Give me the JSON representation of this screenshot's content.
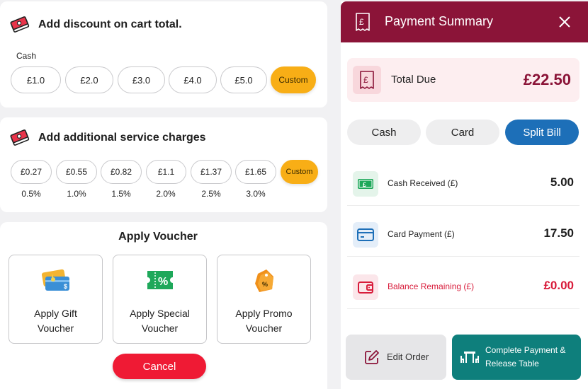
{
  "discount": {
    "title": "Add discount on cart total.",
    "cash_label": "Cash",
    "options": [
      "£1.0",
      "£2.0",
      "£3.0",
      "£4.0",
      "£5.0"
    ],
    "custom_label": "Custom"
  },
  "service": {
    "title": "Add additional service charges",
    "options": [
      {
        "amount": "£0.27",
        "pct": "0.5%"
      },
      {
        "amount": "£0.55",
        "pct": "1.0%"
      },
      {
        "amount": "£0.82",
        "pct": "1.5%"
      },
      {
        "amount": "£1.1",
        "pct": "2.0%"
      },
      {
        "amount": "£1.37",
        "pct": "2.5%"
      },
      {
        "amount": "£1.65",
        "pct": "3.0%"
      }
    ],
    "custom_label": "Custom"
  },
  "voucher": {
    "title": "Apply Voucher",
    "items": [
      {
        "line1": "Apply Gift",
        "line2": "Voucher",
        "icon": "gift-card-icon"
      },
      {
        "line1": "Apply Special",
        "line2": "Voucher",
        "icon": "percent-ticket-icon"
      },
      {
        "line1": "Apply Promo",
        "line2": "Voucher",
        "icon": "promo-tag-icon"
      }
    ],
    "cancel_label": "Cancel"
  },
  "payment": {
    "title": "Payment Summary",
    "total_label": "Total Due",
    "total_value": "£22.50",
    "tabs": [
      "Cash",
      "Card",
      "Split Bill"
    ],
    "active_tab": "Split Bill",
    "rows": [
      {
        "label": "Cash Received (£)",
        "value": "5.00"
      },
      {
        "label": "Card Payment (£)",
        "value": "17.50"
      },
      {
        "label": "Balance Remaining (£)",
        "value": "£0.00"
      }
    ],
    "edit_label": "Edit Order",
    "complete_line1": "Complete Payment &",
    "complete_line2": "Release Table"
  },
  "colors": {
    "brand": "#8b1438",
    "accent_orange": "#f8ae16",
    "active_tab": "#1d6fb8",
    "cancel_red": "#ef1a34",
    "complete_teal": "#0e7f7c",
    "balance_red": "#d81b3a"
  }
}
